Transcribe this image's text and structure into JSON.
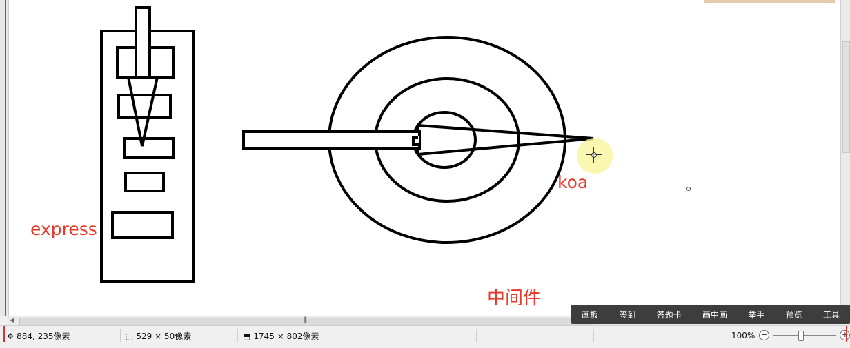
{
  "canvas": {
    "labels": {
      "express": "express",
      "koa": "koa",
      "middleware": "中间件"
    }
  },
  "floating_toolbar": {
    "buttons": [
      "画板",
      "签到",
      "答题卡",
      "画中画",
      "举手",
      "预览",
      "工具"
    ]
  },
  "status_bar": {
    "cursor_position": "884, 235像素",
    "selection_size": "529 × 50像素",
    "image_size": "1745 × 802像素",
    "zoom_level": "100%",
    "zoom_fraction": 0.43
  },
  "icons": {
    "cursor": "crosshair-cursor-icon",
    "position": "move-cursor-icon",
    "selection": "selection-size-icon",
    "image": "image-size-icon",
    "zoom_out": "zoom-out-icon",
    "zoom_in": "zoom-in-icon"
  },
  "colors": {
    "label_red": "#e53a2a",
    "toolbar_bg": "#3d3d3d",
    "highlight_yellow": "#f8f496"
  }
}
